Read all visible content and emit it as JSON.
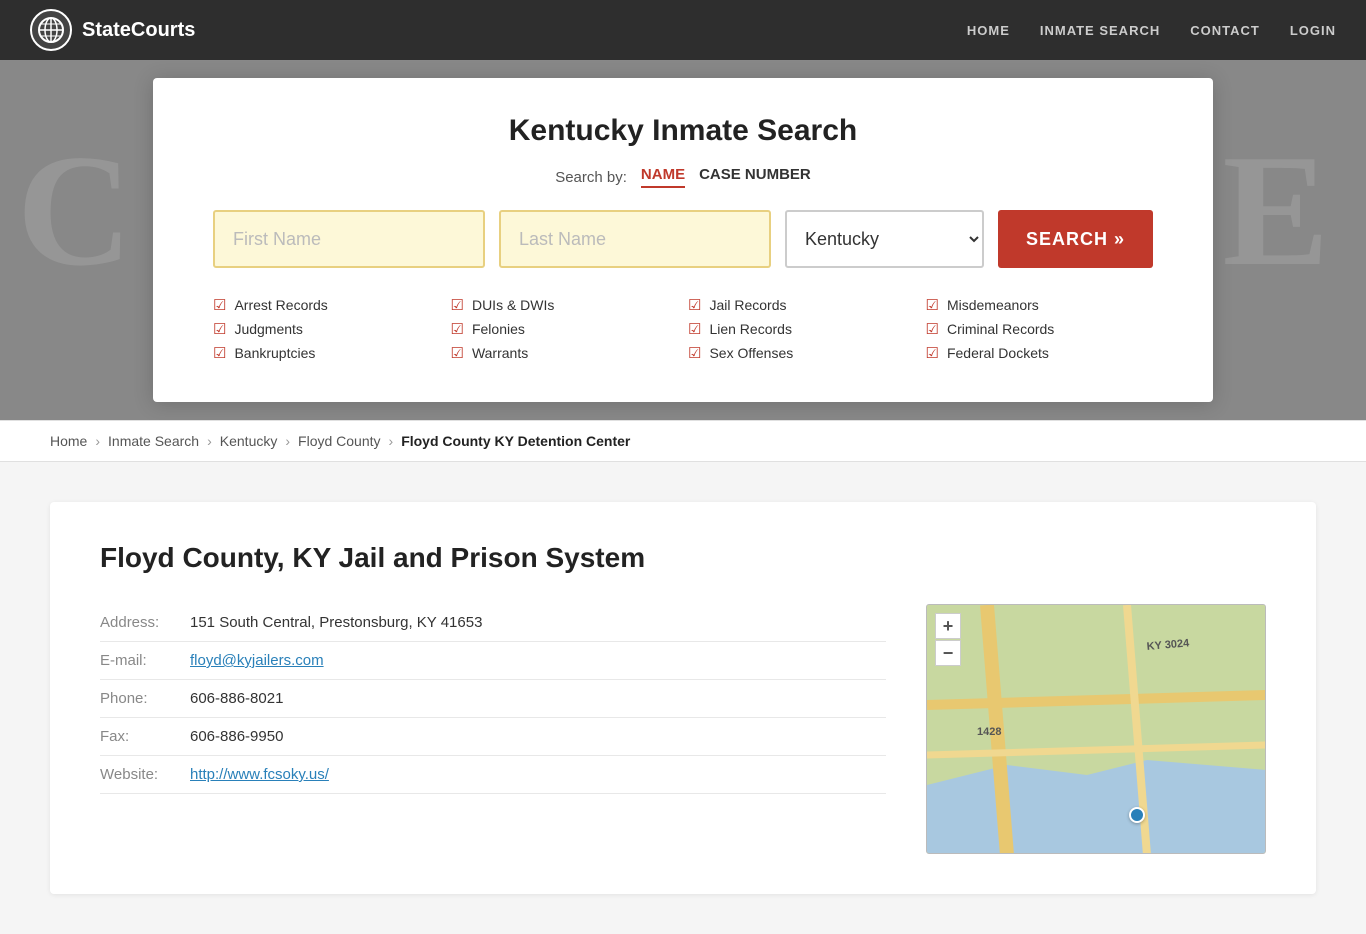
{
  "header": {
    "logo_text": "StateCourts",
    "nav": {
      "home": "HOME",
      "inmate_search": "INMATE SEARCH",
      "contact": "CONTACT",
      "login": "LOGIN"
    }
  },
  "hero": {
    "bg_text": "COURTHOUSE"
  },
  "search_card": {
    "title": "Kentucky Inmate Search",
    "search_by_label": "Search by:",
    "tab_name": "NAME",
    "tab_case_number": "CASE NUMBER",
    "first_name_placeholder": "First Name",
    "last_name_placeholder": "Last Name",
    "state_value": "Kentucky",
    "search_button": "SEARCH »",
    "checkboxes": [
      [
        "Arrest Records",
        "Judgments",
        "Bankruptcies"
      ],
      [
        "DUIs & DWIs",
        "Felonies",
        "Warrants"
      ],
      [
        "Jail Records",
        "Lien Records",
        "Sex Offenses"
      ],
      [
        "Misdemeanors",
        "Criminal Records",
        "Federal Dockets"
      ]
    ]
  },
  "breadcrumb": {
    "home": "Home",
    "inmate_search": "Inmate Search",
    "kentucky": "Kentucky",
    "floyd_county": "Floyd County",
    "current": "Floyd County KY Detention Center"
  },
  "facility": {
    "title": "Floyd County, KY Jail and Prison System",
    "address_label": "Address:",
    "address_value": "151 South Central, Prestonsburg, KY 41653",
    "email_label": "E-mail:",
    "email_value": "floyd@kyjailers.com",
    "phone_label": "Phone:",
    "phone_value": "606-886-8021",
    "fax_label": "Fax:",
    "fax_value": "606-886-9950",
    "website_label": "Website:",
    "website_value": "http://www.fcsoky.us/"
  },
  "map": {
    "zoom_in": "+",
    "zoom_out": "−",
    "road_label_1": "KY 3024",
    "road_label_2": "1428"
  }
}
